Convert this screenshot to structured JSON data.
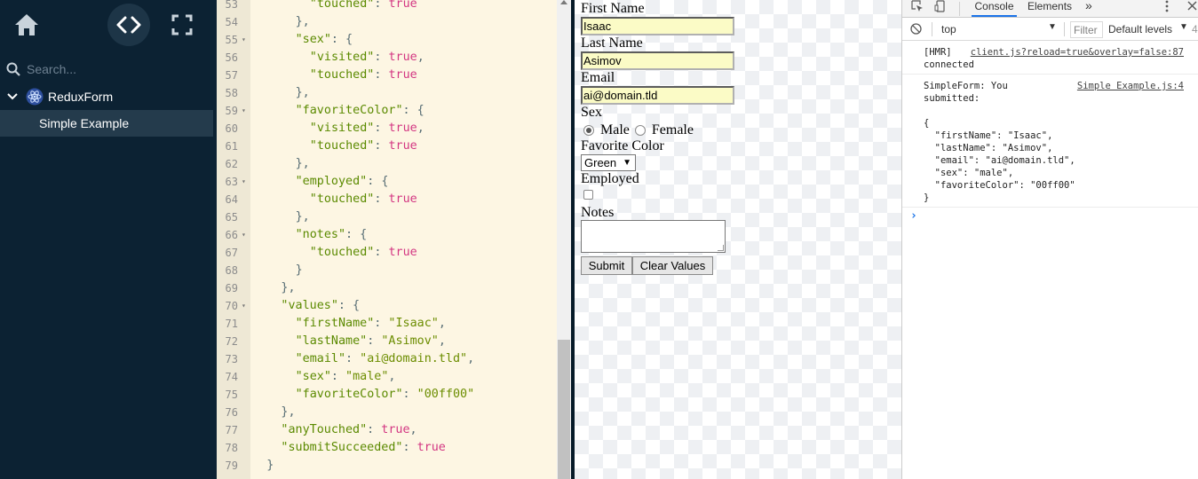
{
  "sidebar": {
    "search_placeholder": "Search...",
    "group": "ReduxForm",
    "item": "Simple Example"
  },
  "code": {
    "lines": [
      {
        "num": "53",
        "fold": "",
        "indent": 8,
        "tokens": [
          [
            "key",
            "\"touched\""
          ],
          [
            "punc",
            ": "
          ],
          [
            "bool",
            "true"
          ]
        ]
      },
      {
        "num": "54",
        "fold": "",
        "indent": 6,
        "tokens": [
          [
            "punc",
            "},"
          ]
        ]
      },
      {
        "num": "55",
        "fold": "▾",
        "indent": 6,
        "tokens": [
          [
            "key",
            "\"sex\""
          ],
          [
            "punc",
            ": {"
          ]
        ]
      },
      {
        "num": "56",
        "fold": "",
        "indent": 8,
        "tokens": [
          [
            "key",
            "\"visited\""
          ],
          [
            "punc",
            ": "
          ],
          [
            "bool",
            "true"
          ],
          [
            "punc",
            ","
          ]
        ]
      },
      {
        "num": "57",
        "fold": "",
        "indent": 8,
        "tokens": [
          [
            "key",
            "\"touched\""
          ],
          [
            "punc",
            ": "
          ],
          [
            "bool",
            "true"
          ]
        ]
      },
      {
        "num": "58",
        "fold": "",
        "indent": 6,
        "tokens": [
          [
            "punc",
            "},"
          ]
        ]
      },
      {
        "num": "59",
        "fold": "▾",
        "indent": 6,
        "tokens": [
          [
            "key",
            "\"favoriteColor\""
          ],
          [
            "punc",
            ": {"
          ]
        ]
      },
      {
        "num": "60",
        "fold": "",
        "indent": 8,
        "tokens": [
          [
            "key",
            "\"visited\""
          ],
          [
            "punc",
            ": "
          ],
          [
            "bool",
            "true"
          ],
          [
            "punc",
            ","
          ]
        ]
      },
      {
        "num": "61",
        "fold": "",
        "indent": 8,
        "tokens": [
          [
            "key",
            "\"touched\""
          ],
          [
            "punc",
            ": "
          ],
          [
            "bool",
            "true"
          ]
        ]
      },
      {
        "num": "62",
        "fold": "",
        "indent": 6,
        "tokens": [
          [
            "punc",
            "},"
          ]
        ]
      },
      {
        "num": "63",
        "fold": "▾",
        "indent": 6,
        "tokens": [
          [
            "key",
            "\"employed\""
          ],
          [
            "punc",
            ": {"
          ]
        ]
      },
      {
        "num": "64",
        "fold": "",
        "indent": 8,
        "tokens": [
          [
            "key",
            "\"touched\""
          ],
          [
            "punc",
            ": "
          ],
          [
            "bool",
            "true"
          ]
        ]
      },
      {
        "num": "65",
        "fold": "",
        "indent": 6,
        "tokens": [
          [
            "punc",
            "},"
          ]
        ]
      },
      {
        "num": "66",
        "fold": "▾",
        "indent": 6,
        "tokens": [
          [
            "key",
            "\"notes\""
          ],
          [
            "punc",
            ": {"
          ]
        ]
      },
      {
        "num": "67",
        "fold": "",
        "indent": 8,
        "tokens": [
          [
            "key",
            "\"touched\""
          ],
          [
            "punc",
            ": "
          ],
          [
            "bool",
            "true"
          ]
        ]
      },
      {
        "num": "68",
        "fold": "",
        "indent": 6,
        "tokens": [
          [
            "punc",
            "}"
          ]
        ]
      },
      {
        "num": "69",
        "fold": "",
        "indent": 4,
        "tokens": [
          [
            "punc",
            "},"
          ]
        ]
      },
      {
        "num": "70",
        "fold": "▾",
        "indent": 4,
        "tokens": [
          [
            "key",
            "\"values\""
          ],
          [
            "punc",
            ": {"
          ]
        ]
      },
      {
        "num": "71",
        "fold": "",
        "indent": 6,
        "tokens": [
          [
            "key",
            "\"firstName\""
          ],
          [
            "punc",
            ": "
          ],
          [
            "str",
            "\"Isaac\""
          ],
          [
            "punc",
            ","
          ]
        ]
      },
      {
        "num": "72",
        "fold": "",
        "indent": 6,
        "tokens": [
          [
            "key",
            "\"lastName\""
          ],
          [
            "punc",
            ": "
          ],
          [
            "str",
            "\"Asimov\""
          ],
          [
            "punc",
            ","
          ]
        ]
      },
      {
        "num": "73",
        "fold": "",
        "indent": 6,
        "tokens": [
          [
            "key",
            "\"email\""
          ],
          [
            "punc",
            ": "
          ],
          [
            "str",
            "\"ai@domain.tld\""
          ],
          [
            "punc",
            ","
          ]
        ]
      },
      {
        "num": "74",
        "fold": "",
        "indent": 6,
        "tokens": [
          [
            "key",
            "\"sex\""
          ],
          [
            "punc",
            ": "
          ],
          [
            "str",
            "\"male\""
          ],
          [
            "punc",
            ","
          ]
        ]
      },
      {
        "num": "75",
        "fold": "",
        "indent": 6,
        "tokens": [
          [
            "key",
            "\"favoriteColor\""
          ],
          [
            "punc",
            ": "
          ],
          [
            "str",
            "\"00ff00\""
          ]
        ]
      },
      {
        "num": "76",
        "fold": "",
        "indent": 4,
        "tokens": [
          [
            "punc",
            "},"
          ]
        ]
      },
      {
        "num": "77",
        "fold": "",
        "indent": 4,
        "tokens": [
          [
            "key",
            "\"anyTouched\""
          ],
          [
            "punc",
            ": "
          ],
          [
            "bool",
            "true"
          ],
          [
            "punc",
            ","
          ]
        ]
      },
      {
        "num": "78",
        "fold": "",
        "indent": 4,
        "tokens": [
          [
            "key",
            "\"submitSucceeded\""
          ],
          [
            "punc",
            ": "
          ],
          [
            "bool",
            "true"
          ]
        ]
      },
      {
        "num": "79",
        "fold": "",
        "indent": 2,
        "tokens": [
          [
            "punc",
            "}"
          ]
        ]
      }
    ]
  },
  "form": {
    "first_name_label": "First Name",
    "first_name_value": "Isaac",
    "last_name_label": "Last Name",
    "last_name_value": "Asimov",
    "email_label": "Email",
    "email_value": "ai@domain.tld",
    "sex_label": "Sex",
    "male_label": "Male",
    "female_label": "Female",
    "sex_selected": "male",
    "favorite_color_label": "Favorite Color",
    "favorite_color_value": "Green",
    "employed_label": "Employed",
    "employed_checked": false,
    "notes_label": "Notes",
    "submit_label": "Submit",
    "clear_label": "Clear Values"
  },
  "devtools": {
    "tab_console": "Console",
    "tab_elements": "Elements",
    "more_tabs": "»",
    "context": "top",
    "filter_placeholder": "Filter",
    "levels": "Default levels",
    "messages": [
      {
        "lines": [
          "[HMR]",
          "connected"
        ],
        "source": "client.js?reload=true&overlay=false:87"
      },
      {
        "lines": [
          "SimpleForm: You",
          "submitted:",
          "",
          "{",
          "  \"firstName\": \"Isaac\",",
          "  \"lastName\": \"Asimov\",",
          "  \"email\": \"ai@domain.tld\",",
          "  \"sex\": \"male\",",
          "  \"favoriteColor\": \"00ff00\"",
          "}"
        ],
        "source": "Simple Example.js:4"
      }
    ],
    "prompt": "›"
  }
}
